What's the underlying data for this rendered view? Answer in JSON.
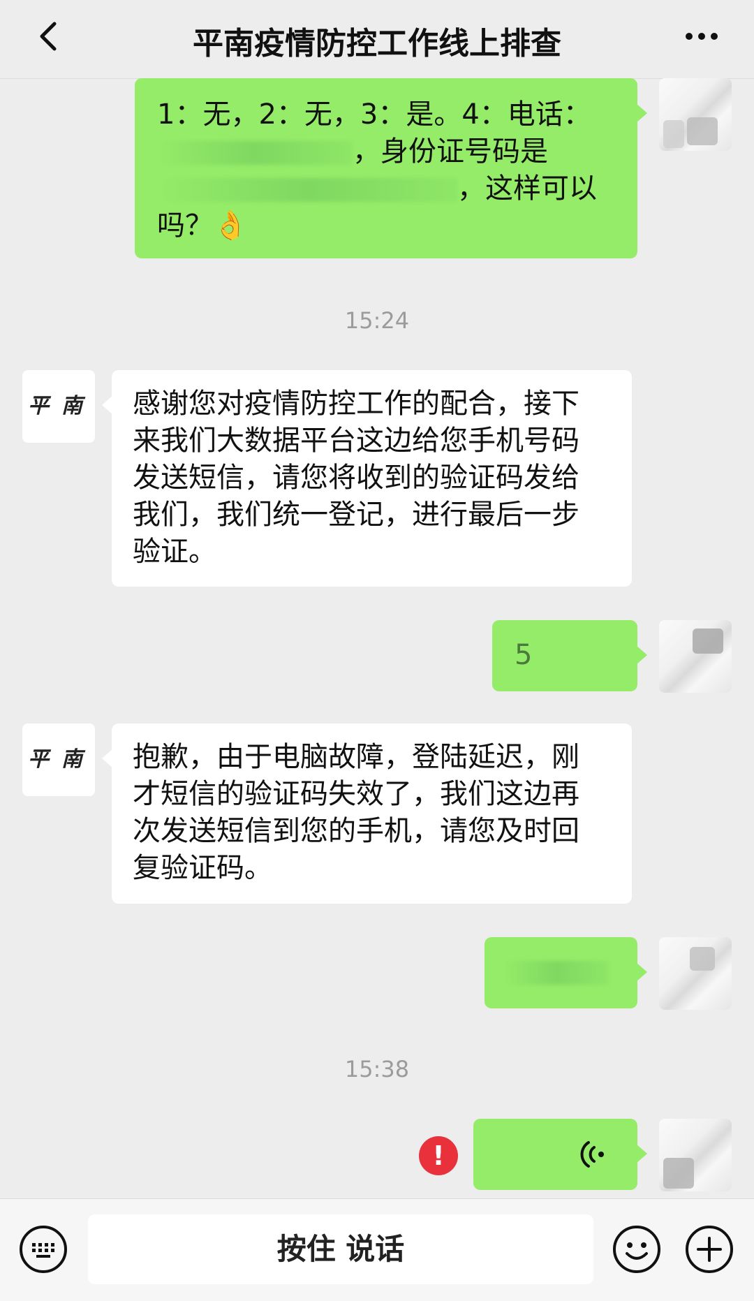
{
  "header": {
    "title": "平南疫情防控工作线上排查",
    "back_icon": "chevron-left-icon",
    "more_icon": "more-horizontal-icon"
  },
  "messages": [
    {
      "from": "self",
      "lines": [
        "1：无，2：无，3：是。4：电话：",
        "，身份证号码是",
        "，这样可以",
        "吗？👌"
      ]
    },
    {
      "timestamp": "15:24"
    },
    {
      "from": "other",
      "avatar_text": "平南",
      "lines": [
        "感谢您对疫情防控工作的配合，接下",
        "来我们大数据平台这边给您手机号码",
        "发送短信，请您将收到的验证码发给",
        "我们，我们统一登记，进行最后一步",
        "验证。"
      ]
    },
    {
      "from": "self",
      "text": "5"
    },
    {
      "from": "other",
      "avatar_text": "平南",
      "lines": [
        "抱歉，由于电脑故障，登陆延迟，刚",
        "才短信的验证码失效了，我们这边再",
        "次发送短信到您的手机，请您及时回",
        "复验证码。"
      ]
    },
    {
      "from": "self",
      "text": ""
    },
    {
      "timestamp": "15:38"
    },
    {
      "from": "self",
      "type": "voice",
      "status": "failed",
      "status_icon": "error-icon"
    }
  ],
  "footer": {
    "talk_label": "按住 说话",
    "keyboard_icon": "keyboard-icon",
    "emoji_icon": "emoji-icon",
    "plus_icon": "plus-icon"
  },
  "colors": {
    "background": "#ededed",
    "bubble_self": "#95ec69",
    "bubble_other": "#ffffff",
    "error": "#e8313b"
  }
}
